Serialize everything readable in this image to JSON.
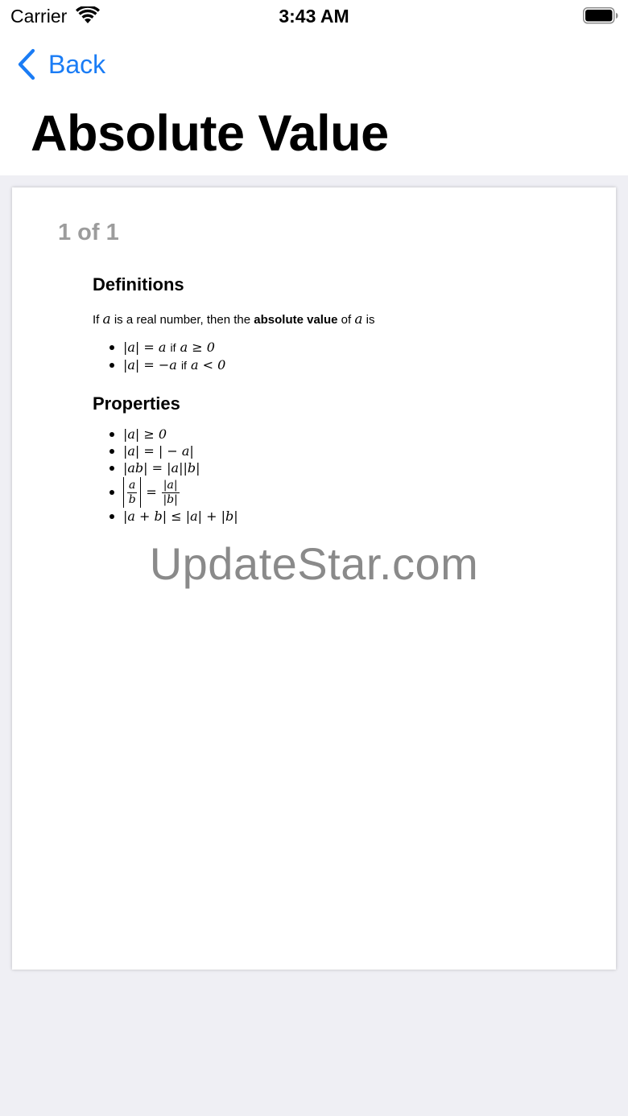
{
  "status_bar": {
    "carrier": "Carrier",
    "time": "3:43 AM"
  },
  "nav": {
    "back_label": "Back",
    "title": "Absolute Value"
  },
  "document": {
    "page_counter": "1 of 1",
    "definitions_heading": "Definitions",
    "intro": {
      "part1": "If ",
      "var1": "a",
      "part2": " is a real number, then the ",
      "bold": "absolute value",
      "part3": " of ",
      "var2": "a",
      "part4": " is"
    },
    "definitions": [
      {
        "lhs": "|a| = a",
        "cond_word": "if",
        "cond": "a ≥ 0"
      },
      {
        "lhs": "|a| = −a",
        "cond_word": "if",
        "cond": "a < 0"
      }
    ],
    "properties_heading": "Properties",
    "properties": [
      "|a| ≥ 0",
      "|a| = | − a|",
      "|ab| = |a||b|",
      "|a + b| ≤ |a| + |b|"
    ],
    "fraction_property": {
      "num": "a",
      "den": "b",
      "rhs_num": "|a|",
      "rhs_den": "|b|"
    }
  },
  "watermark": "UpdateStar.com"
}
